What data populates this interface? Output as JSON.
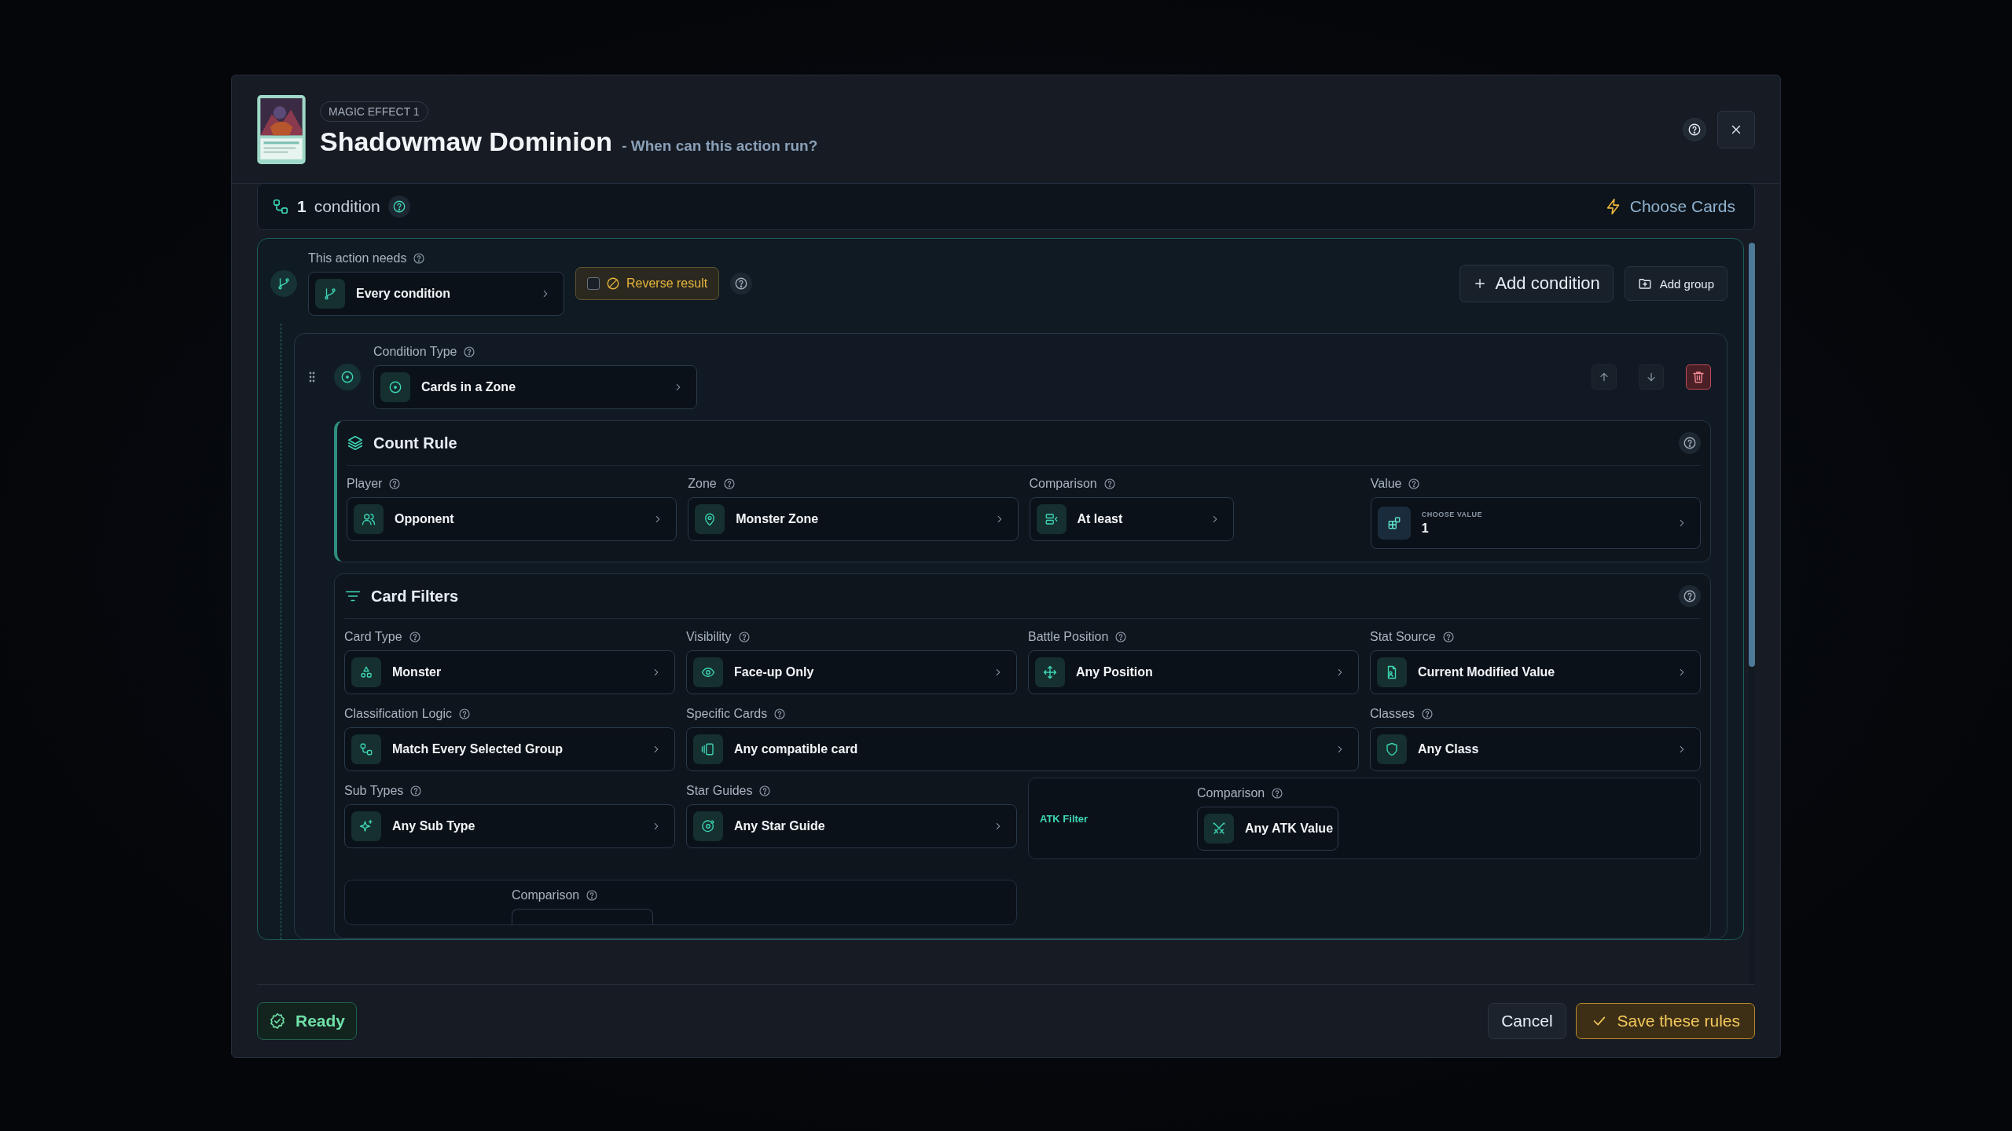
{
  "header": {
    "badge": "MAGIC EFFECT 1",
    "title": "Shadowmaw Dominion",
    "subtitle": "- When can this action run?"
  },
  "condition_bar": {
    "count": "1",
    "label": "condition",
    "action": "Choose Cards"
  },
  "group": {
    "label": "This action needs",
    "value": "Every condition",
    "reverse": {
      "label": "Reverse result",
      "checked": false
    },
    "buttons": [
      "Add condition",
      "Add group"
    ]
  },
  "condition": {
    "label": "Condition Type",
    "value": "Cards in a Zone",
    "count_rule": {
      "title": "Count Rule",
      "fields": [
        {
          "label": "Player",
          "value": "Opponent",
          "kind": "select"
        },
        {
          "label": "Zone",
          "value": "Monster Zone",
          "kind": "select"
        },
        {
          "label": "Comparison",
          "value": "At least",
          "kind": "select"
        },
        {
          "label": "Value",
          "caption": "CHOOSE VALUE",
          "value": "1",
          "kind": "value"
        }
      ]
    },
    "card_filters": {
      "title": "Card Filters",
      "fields": [
        {
          "label": "Card Type",
          "value": "Monster"
        },
        {
          "label": "Visibility",
          "value": "Face-up Only"
        },
        {
          "label": "Battle Position",
          "value": "Any Position"
        },
        {
          "label": "Stat Source",
          "value": "Current Modified Value"
        },
        {
          "label": "Classification Logic",
          "value": "Match Every Selected Group"
        },
        {
          "label": "Specific Cards",
          "value": "Any compatible card"
        },
        {
          "label": "Classes",
          "value": "Any Class"
        },
        {
          "label": "Sub Types",
          "value": "Any Sub Type"
        },
        {
          "label": "Star Guides",
          "value": "Any Star Guide"
        }
      ],
      "atk_filter": {
        "title": "ATK Filter",
        "label": "Comparison",
        "value": "Any ATK Value"
      },
      "def_filter": {
        "label": "Comparison"
      }
    }
  },
  "footer": {
    "status": "Ready",
    "buttons": [
      "Cancel",
      "Save these rules"
    ]
  }
}
